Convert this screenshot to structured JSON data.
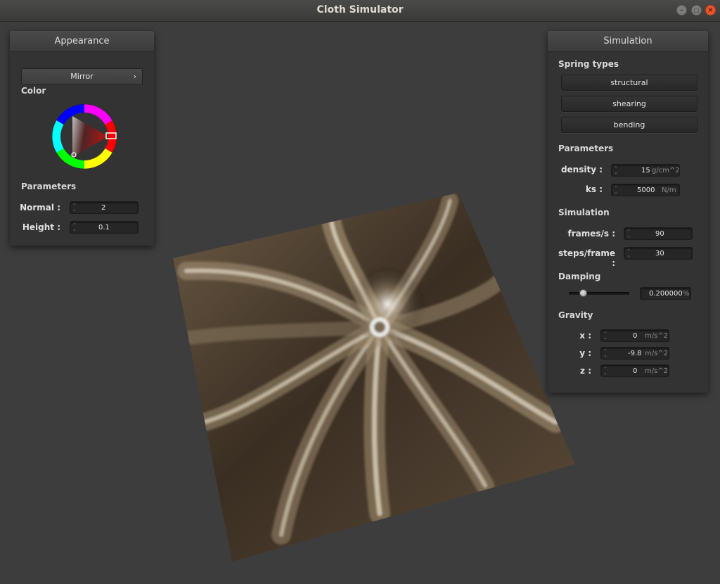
{
  "window": {
    "title": "Cloth Simulator"
  },
  "appearance": {
    "title": "Appearance",
    "shader_selected": "Mirror",
    "color_label": "Color",
    "parameters_label": "Parameters",
    "normal": {
      "label": "Normal :",
      "value": "2"
    },
    "height": {
      "label": "Height :",
      "value": "0.1"
    },
    "color_hue": "#e6201e"
  },
  "simulation": {
    "title": "Simulation",
    "spring_types_label": "Spring types",
    "spring_types": [
      "structural",
      "shearing",
      "bending"
    ],
    "parameters_label": "Parameters",
    "density": {
      "label": "density :",
      "value": "15",
      "unit": "g/cm^2"
    },
    "ks": {
      "label": "ks :",
      "value": "5000",
      "unit": "N/m"
    },
    "simulation_label": "Simulation",
    "frames": {
      "label": "frames/s :",
      "value": "90"
    },
    "steps": {
      "label": "steps/frame :",
      "value": "30"
    },
    "damping_label": "Damping",
    "damping": {
      "value": "0.200000",
      "unit": "%",
      "slider_fraction": 0.2
    },
    "gravity_label": "Gravity",
    "gravity": {
      "x": {
        "label": "x :",
        "value": "0",
        "unit": "m/s^2"
      },
      "y": {
        "label": "y :",
        "value": "-9.8",
        "unit": "m/s^2"
      },
      "z": {
        "label": "z :",
        "value": "0",
        "unit": "m/s^2"
      }
    }
  }
}
